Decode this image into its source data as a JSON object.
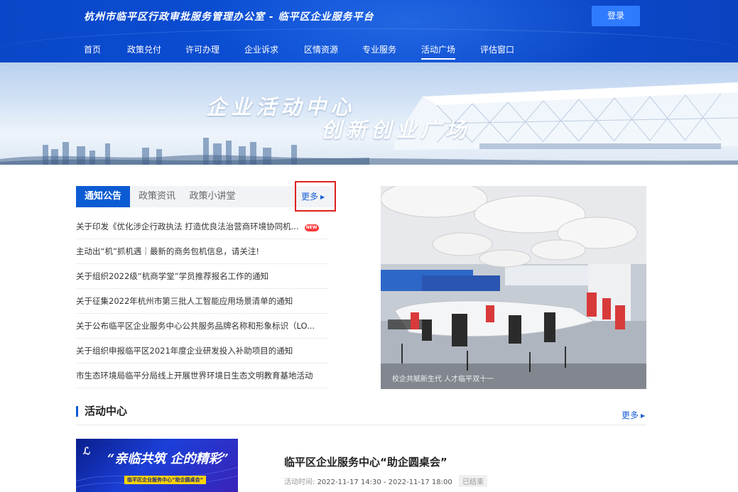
{
  "header": {
    "site_title": "杭州市临平区行政审批服务管理办公室 - 临平区企业服务平台",
    "login_label": "登录"
  },
  "nav": {
    "items": [
      {
        "label": "首页"
      },
      {
        "label": "政策兑付"
      },
      {
        "label": "许可办理"
      },
      {
        "label": "企业诉求"
      },
      {
        "label": "区情资源"
      },
      {
        "label": "专业服务"
      },
      {
        "label": "活动广场"
      },
      {
        "label": "评估窗口"
      }
    ],
    "active": "活动广场"
  },
  "banner": {
    "title": "企业活动中心",
    "subtitle": "创新创业广场"
  },
  "notice": {
    "tabs": [
      {
        "label": "通知公告"
      },
      {
        "label": "政策资讯"
      },
      {
        "label": "政策小讲堂"
      }
    ],
    "more_label": "更多",
    "items": [
      {
        "text": "关于印发《优化涉企行政执法 打造优良法治营商环境协同机...",
        "badge": "NEW"
      },
      {
        "text": "主动出“机”抓机遇｜最新的商务包机信息，请关注!"
      },
      {
        "text": "关于组织2022级“杭商学堂”学员推荐报名工作的通知"
      },
      {
        "text": "关于征集2022年杭州市第三批人工智能应用场景清单的通知"
      },
      {
        "text": "关于公布临平区企业服务中心公共服务品牌名称和形象标识（LO..."
      },
      {
        "text": "关于组织申报临平区2021年度企业研发投入补助项目的通知"
      },
      {
        "text": "市生态环境局临平分局线上开展世界环境日生态文明教育基地活动"
      }
    ]
  },
  "photo": {
    "caption": "校企共赋新生代 人才临平双十一"
  },
  "activity": {
    "section_title": "活动中心",
    "more_label": "更多",
    "title": "临平区企业服务中心“助企圆桌会”",
    "time_label": "活动时间:",
    "time_value": "2022-11-17 14:30 - 2022-11-17 18:00",
    "status": "已结束",
    "image_text": "“亲临共筑 企的精彩”",
    "image_subtext": "临平区企业服务中心“助企圆桌会”"
  },
  "colors": {
    "header_blue": "#0b4fd6",
    "accent_blue": "#0b5bd3",
    "highlight_red": "#e02020",
    "new_badge": "#ff3b3b"
  }
}
